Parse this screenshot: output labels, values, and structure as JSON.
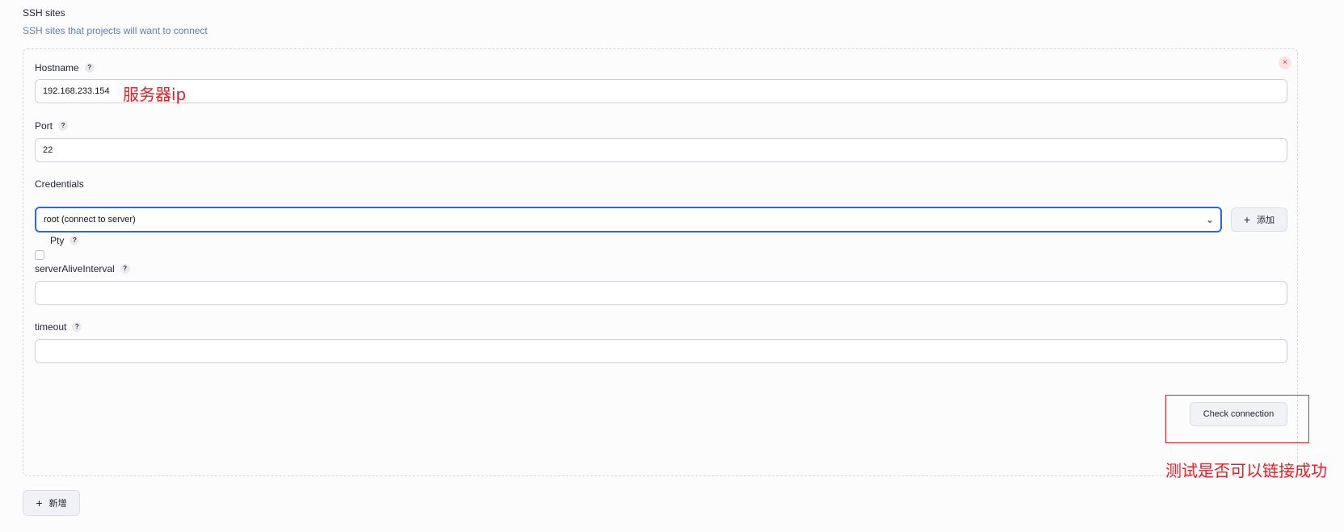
{
  "section": {
    "title": "SSH sites",
    "description": "SSH sites that projects will want to connect"
  },
  "card": {
    "close_icon": "×",
    "hostname": {
      "label": "Hostname",
      "value": "192.168.233.154",
      "annotation": "服务器ip"
    },
    "port": {
      "label": "Port",
      "value": "22"
    },
    "credentials": {
      "label": "Credentials",
      "selected": "root (connect to server)",
      "add_label": "添加"
    },
    "pty": {
      "label": "Pty",
      "checked": false
    },
    "server_alive_interval": {
      "label": "serverAliveInterval",
      "value": ""
    },
    "timeout": {
      "label": "timeout",
      "value": ""
    },
    "check_connection_label": "Check connection",
    "check_annotation": "测试是否可以链接成功"
  },
  "help_glyph": "?",
  "plus_glyph": "+",
  "chevron_glyph": "⌄",
  "new_button_label": "新增",
  "colors": {
    "accent": "#2a69d8",
    "annotation": "#e0202a"
  }
}
